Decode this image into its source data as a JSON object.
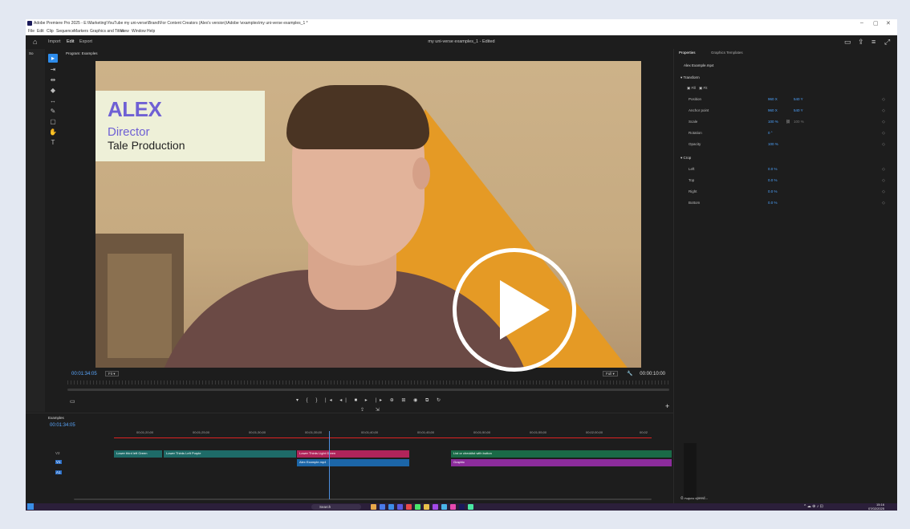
{
  "window": {
    "title": "Adobe Premiere Pro 2025 - E:\\Marketing\\YouTube my uni-verse\\Brand\\For Content Creators (Alex's version)\\Adobe \\examples\\my uni-verse examples_1 *",
    "minimize": "–",
    "maximize": "▢",
    "close": "✕"
  },
  "menu": [
    "File",
    "Edit",
    "Clip",
    "Sequence",
    "Markers",
    "Graphics and Titles",
    "View",
    "Window",
    "Help"
  ],
  "workspace": {
    "tabs": [
      "Import",
      "Edit",
      "Export"
    ],
    "active": "Edit",
    "project_title": "my uni-verse examples_1 - Edited"
  },
  "left_panel": {
    "label": "So"
  },
  "program_monitor": {
    "header": "Program: Examples",
    "lower_third": {
      "name": "ALEX",
      "role": "Director",
      "company": "Tale Production"
    },
    "timecode_current": "00:01:34:05",
    "fit": "Fit",
    "quality": "Full",
    "timecode_duration": "00:00:10:00"
  },
  "properties": {
    "tabs": [
      "Properties",
      "Graphics Templates"
    ],
    "clip_name": "Alex Example.mp4",
    "transform_label": "Transform",
    "fill_labels": [
      "Fill",
      "Fit"
    ],
    "rows": [
      {
        "label": "Position",
        "v1": "960 X",
        "v2": "540 Y"
      },
      {
        "label": "Anchor point",
        "v1": "960 X",
        "v2": "540 Y"
      },
      {
        "label": "Scale",
        "v1": "100 %",
        "v2": "100 %"
      },
      {
        "label": "Rotation",
        "v1": "0 °",
        "v2": ""
      },
      {
        "label": "Opacity",
        "v1": "100 %",
        "v2": ""
      }
    ],
    "crop_label": "Crop",
    "crop_rows": [
      {
        "label": "Left",
        "v1": "0.0 %"
      },
      {
        "label": "Top",
        "v1": "0.0 %"
      },
      {
        "label": "Right",
        "v1": "0.0 %"
      },
      {
        "label": "Bottom",
        "v1": "0.0 %"
      }
    ],
    "adjust_speed": "Adjust speed..."
  },
  "timeline": {
    "header": "Examples",
    "timecode": "00:01:34:05",
    "ruler_labels": [
      "00;01;20;00",
      "00;01;25;00",
      "00;01;30;00",
      "00;01;35;00",
      "00;01;40;00",
      "00;01;45;00",
      "00;01;50;00",
      "00;01;55;00",
      "00;02;00;00",
      "00;02"
    ],
    "tracks": {
      "v3": "V3",
      "v2": "V2",
      "v1": "V1",
      "a1": "A1"
    },
    "clips_v2": [
      "Lower third left Green",
      "Lower Thirds Left Purple",
      "Lower Thirds Light Green",
      "List or checklist with button"
    ],
    "clips_v1": [
      "Alex Example.mp4",
      "Graphic"
    ]
  },
  "taskbar": {
    "search": "Search",
    "time": "15:16",
    "date": "07/02/2025"
  }
}
